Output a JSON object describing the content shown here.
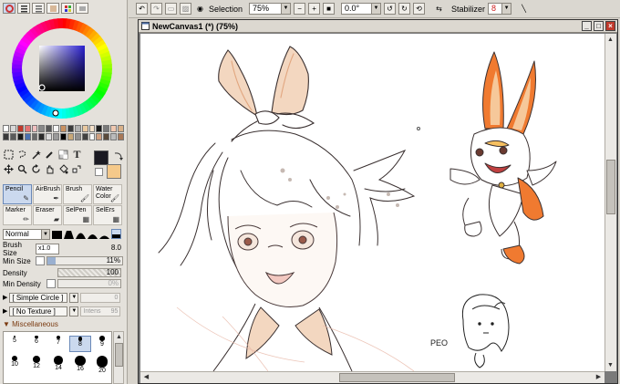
{
  "toolbar": {
    "selection_label": "Selection",
    "zoom_value": "75%",
    "rotation_value": "0.0°",
    "stabilizer_label": "Stabilizer",
    "stabilizer_value": "8"
  },
  "canvas_window": {
    "title": "NewCanvas1 (*) (75%)"
  },
  "colors": {
    "main": "#1a1a22",
    "sub": "#f5c98a",
    "swatches_row1": [
      "#ffffff",
      "#d9d9d9",
      "#c0392b",
      "#e57373",
      "#f0c0c0",
      "#888888",
      "#555555",
      "#f5f5f5",
      "#c89060",
      "#3a3a3a",
      "#b0b0b0",
      "#e8c8a0",
      "#f4e0c8",
      "#1a1a1a",
      "#7a7a7a",
      "#f0c8b0",
      "#d8b088"
    ],
    "swatches_row2": [
      "#3a3a3a",
      "#5a5a5a",
      "#1a1a1a",
      "#4a70b0",
      "#6a6a6a",
      "#2a2a2a",
      "#dddddd",
      "#9a9a9a",
      "#000000",
      "#c8a878",
      "#909090",
      "#404040",
      "#f8f8f8",
      "#d0a080",
      "#5a4a3a",
      "#bbbbbb",
      "#a87858"
    ]
  },
  "brushes": [
    {
      "label": "Pencil"
    },
    {
      "label": "AirBrush"
    },
    {
      "label": "Brush"
    },
    {
      "label": "Water Color"
    },
    {
      "label": "Marker"
    },
    {
      "label": "Eraser"
    },
    {
      "label": "SelPen"
    },
    {
      "label": "SelErs"
    }
  ],
  "blend_mode": "Normal",
  "params": {
    "brush_size_label": "Brush Size",
    "brush_size_mult": "x1.0",
    "brush_size_value": "8.0",
    "min_size_label": "Min Size",
    "min_size_value": "11%",
    "min_size_fraction": 0.11,
    "density_label": "Density",
    "density_value": "100",
    "min_density_label": "Min Density",
    "min_density_value": "0%"
  },
  "options": {
    "circle_label": "[ Simple Circle ]",
    "circle_value": "0",
    "texture_label": "[ No Texture ]",
    "texture_intensity_label": "Intens",
    "texture_intensity_value": "95"
  },
  "misc_label": "Miscellaneous",
  "brush_sizes": [
    {
      "label": "5"
    },
    {
      "label": "6"
    },
    {
      "label": "7"
    },
    {
      "label": "8"
    },
    {
      "label": "9"
    },
    {
      "label": "10"
    },
    {
      "label": "12"
    },
    {
      "label": "14"
    },
    {
      "label": "16"
    },
    {
      "label": "20"
    }
  ],
  "sketch_signature": "PEO"
}
